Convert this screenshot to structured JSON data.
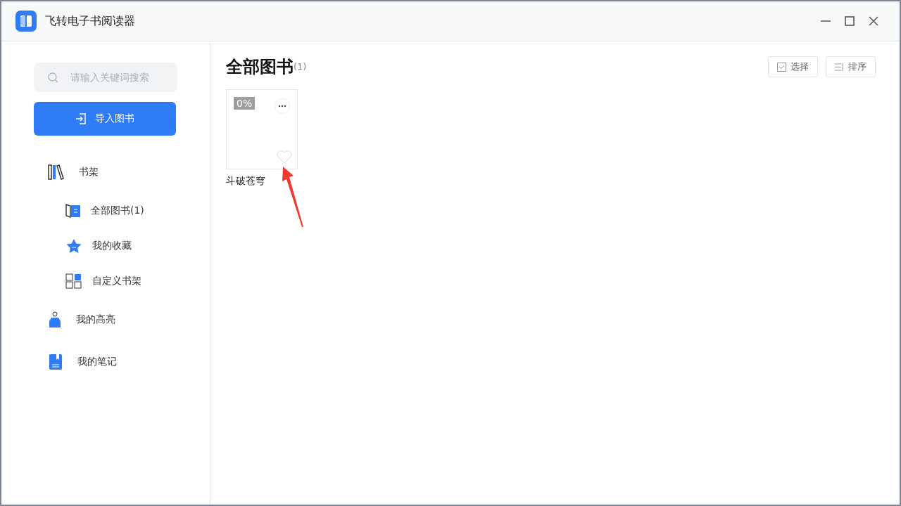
{
  "window": {
    "title": "飞转电子书阅读器"
  },
  "sidebar": {
    "search": {
      "placeholder": "请输入关键词搜索"
    },
    "import_button": "导入图书",
    "items": [
      {
        "label": "书架",
        "kind": "shelf",
        "children": [
          {
            "label": "全部图书(1)",
            "kind": "all"
          },
          {
            "label": "我的收藏",
            "kind": "favorites"
          },
          {
            "label": "自定义书架",
            "kind": "custom"
          }
        ]
      },
      {
        "label": "我的高亮",
        "kind": "highlight"
      },
      {
        "label": "我的笔记",
        "kind": "notes"
      }
    ]
  },
  "main": {
    "title": "全部图书",
    "count": "(1)",
    "buttons": [
      {
        "label": "选择",
        "kind": "select"
      },
      {
        "label": "排序",
        "kind": "sort"
      }
    ],
    "books": [
      {
        "title": "斗破苍穹",
        "progress": "0%",
        "favorite": false
      }
    ]
  }
}
